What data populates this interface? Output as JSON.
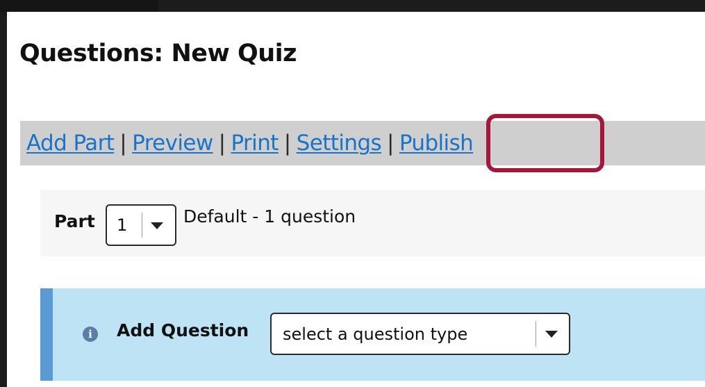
{
  "page": {
    "title": "Questions: New Quiz"
  },
  "toolbar": {
    "add_part": "Add Part",
    "preview": "Preview",
    "print": "Print",
    "settings": "Settings",
    "publish": "Publish",
    "separator": "|"
  },
  "highlight": {
    "target": "Publish",
    "color": "#a3173a"
  },
  "part_row": {
    "label": "Part",
    "selected_part": "1",
    "description": "Default - 1 question",
    "dropdown_icon": "chevron-down-icon"
  },
  "add_question": {
    "info_icon": "info-icon",
    "info_glyph": "i",
    "label": "Add Question",
    "select_value": "select a question type",
    "dropdown_icon": "chevron-down-icon"
  },
  "colors": {
    "link": "#1a73c8",
    "toolbar_bg": "#cfcfcf",
    "info_panel_bg": "#bee3f4",
    "info_panel_accent": "#5b9bd5"
  }
}
